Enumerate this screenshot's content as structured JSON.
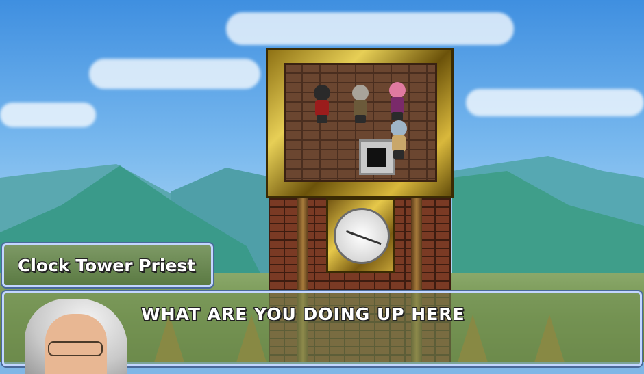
{
  "dialogue": {
    "speaker_name": "Clock Tower Priest",
    "message": "WHAT ARE YOU DOING UP HERE"
  },
  "scene": {
    "sprites": [
      "dark-haired-hero",
      "gray-haired-priest",
      "pink-haired-girl"
    ],
    "colors": {
      "sky": "#78b8ee",
      "mountains": "#3a9a8a",
      "brick": "#7a3a24",
      "gold_frame": "#e6c84a",
      "dialog_border": "#c3d6ff"
    }
  },
  "icons": {
    "clock": "clock-face-icon",
    "stairs": "stairs-down-icon",
    "portrait": "priest-portrait"
  }
}
